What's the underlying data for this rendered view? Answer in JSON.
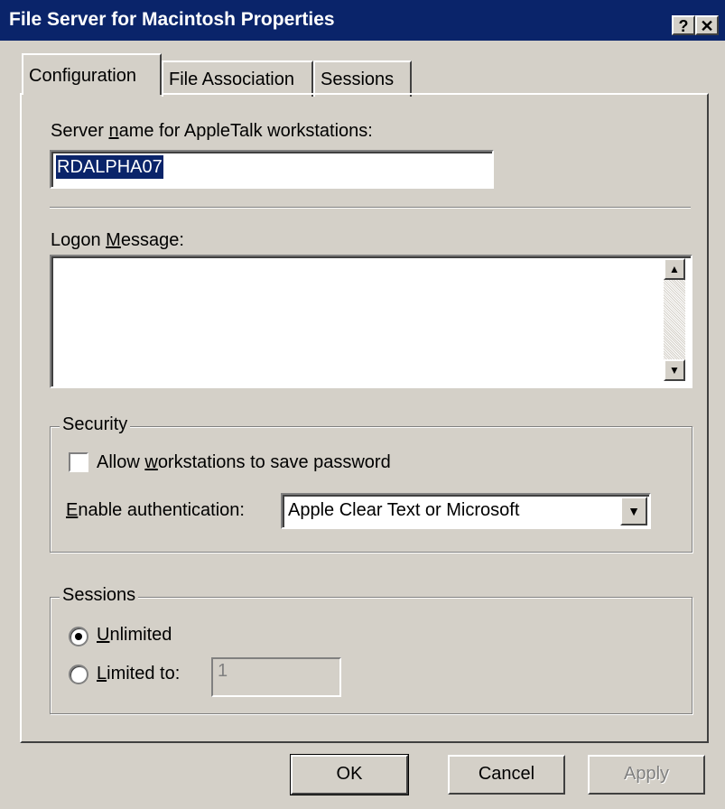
{
  "window": {
    "title": "File Server for Macintosh Properties",
    "help_button": "?",
    "close_button": "✕"
  },
  "tabs": [
    {
      "label": "Configuration",
      "active": true
    },
    {
      "label": "File Association",
      "active": false
    },
    {
      "label": "Sessions",
      "active": false
    }
  ],
  "config": {
    "server_name_label_pre": "Server ",
    "server_name_label_key": "n",
    "server_name_label_post": "ame for AppleTalk workstations:",
    "server_name_value": "RDALPHA07",
    "logon_label_pre": "Logon ",
    "logon_label_key": "M",
    "logon_label_post": "essage:",
    "logon_message": ""
  },
  "security": {
    "title": "Security",
    "checkbox_label_pre": "Allow ",
    "checkbox_label_key": "w",
    "checkbox_label_post": "orkstations to save password",
    "checkbox_checked": false,
    "auth_label_key": "E",
    "auth_label_post": "nable authentication:",
    "auth_value": "Apple Clear Text or Microsoft"
  },
  "sessions": {
    "title": "Sessions",
    "unlimited_key": "U",
    "unlimited_post": "nlimited",
    "limited_key": "L",
    "limited_post": "imited to:",
    "limited_value": "1",
    "selected": "Unlimited"
  },
  "buttons": {
    "ok": "OK",
    "cancel": "Cancel",
    "apply": "Apply"
  }
}
